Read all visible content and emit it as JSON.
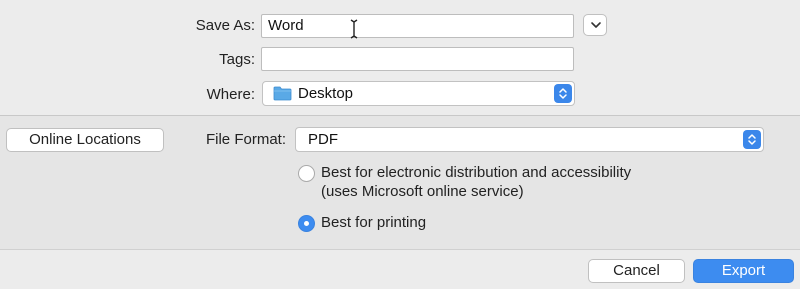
{
  "save_as": {
    "label": "Save As:",
    "value": "Word"
  },
  "tags": {
    "label": "Tags:",
    "value": ""
  },
  "where": {
    "label": "Where:",
    "value": "Desktop",
    "icon": "folder-icon"
  },
  "online_locations_label": "Online Locations",
  "file_format": {
    "label": "File Format:",
    "value": "PDF"
  },
  "options": [
    {
      "line1": "Best for electronic distribution and accessibility",
      "line2": "(uses Microsoft online service)",
      "selected": false
    },
    {
      "line1": "Best for printing",
      "selected": true
    }
  ],
  "buttons": {
    "cancel": "Cancel",
    "export": "Export"
  },
  "colors": {
    "accent": "#3d8cf0",
    "folder": "#5aa9e6"
  }
}
